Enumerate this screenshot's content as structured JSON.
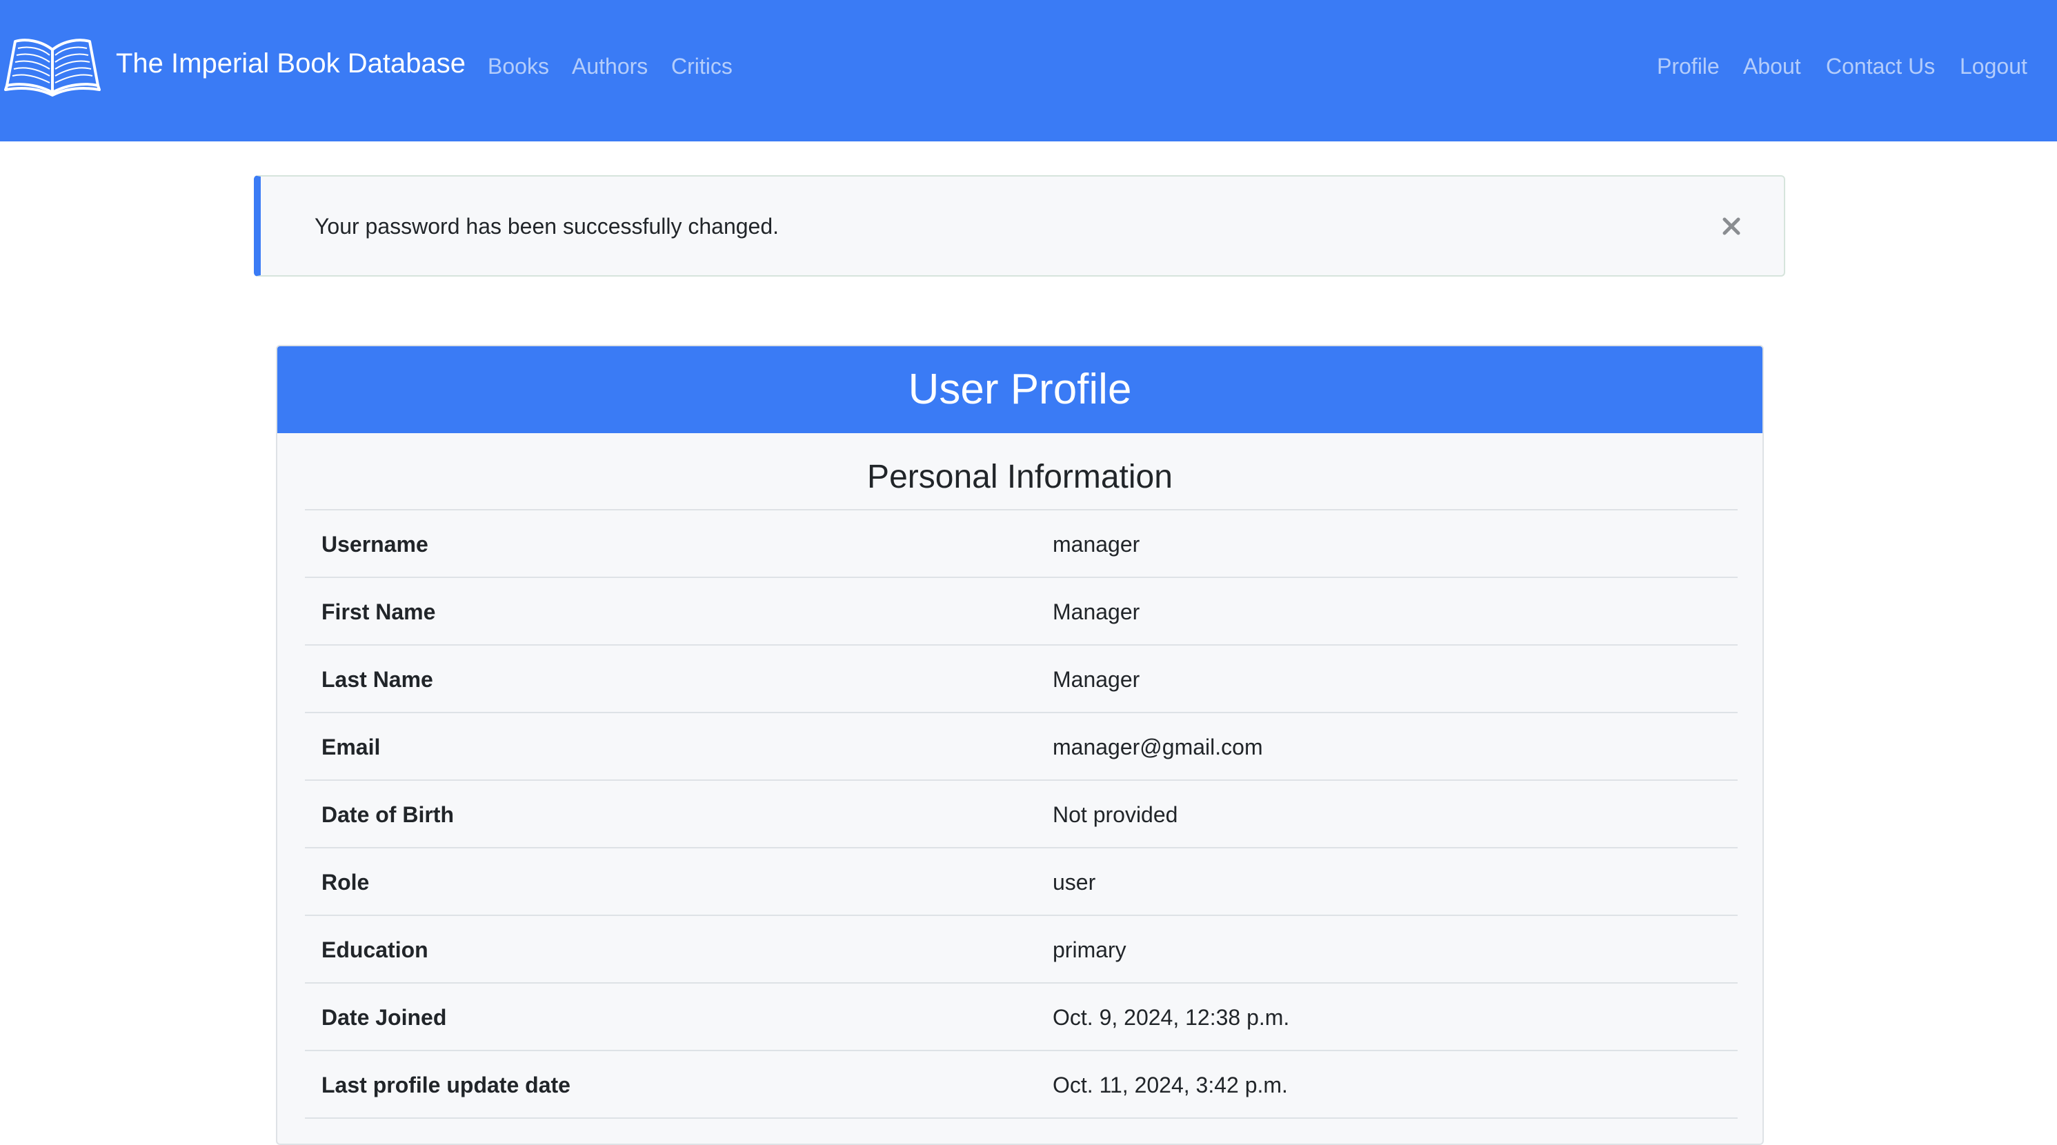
{
  "navbar": {
    "brand_icon": "open-book-icon",
    "brand_title": "The Imperial Book Database",
    "left_links": [
      "Books",
      "Authors",
      "Critics"
    ],
    "right_links": [
      "Profile",
      "About",
      "Contact Us",
      "Logout"
    ],
    "background_color": "#3a7bf5"
  },
  "alert": {
    "message": "Your password has been successfully changed.",
    "close_icon": "close-icon",
    "accent_color": "#3a7bf5"
  },
  "profile_card": {
    "title": "User Profile",
    "section_title": "Personal Information",
    "rows": [
      {
        "label": "Username",
        "value": "manager"
      },
      {
        "label": "First Name",
        "value": "Manager"
      },
      {
        "label": "Last Name",
        "value": "Manager"
      },
      {
        "label": "Email",
        "value": "manager@gmail.com"
      },
      {
        "label": "Date of Birth",
        "value": "Not provided"
      },
      {
        "label": "Role",
        "value": "user"
      },
      {
        "label": "Education",
        "value": "primary"
      },
      {
        "label": "Date Joined",
        "value": "Oct. 9, 2024, 12:38 p.m."
      },
      {
        "label": "Last profile update date",
        "value": "Oct. 11, 2024, 3:42 p.m."
      }
    ]
  }
}
